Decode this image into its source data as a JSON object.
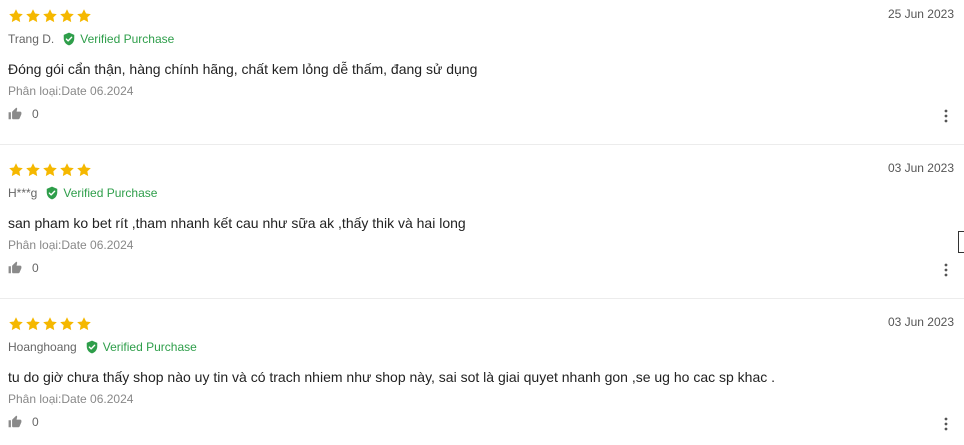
{
  "colors": {
    "star": "#f5b800",
    "verified": "#2e9e4a",
    "divider": "#ececec"
  },
  "verified_label": "Verified Purchase",
  "reviews": [
    {
      "rating": 5,
      "author": "Trang D.",
      "date": "25 Jun 2023",
      "content": "Đóng gói cẩn thận, hàng chính hãng, chất kem lỏng dễ thấm, đang sử dụng",
      "variant": "Phân loại:Date 06.2024",
      "likes": "0"
    },
    {
      "rating": 5,
      "author": "H***g",
      "date": "03 Jun 2023",
      "content": "san pham ko bet rít ,tham nhanh kết cau như sữa ak ,thấy thik và hai long",
      "variant": "Phân loại:Date 06.2024",
      "likes": "0"
    },
    {
      "rating": 5,
      "author": "Hoanghoang",
      "date": "03 Jun 2023",
      "content": "tu do giờ chưa thấy shop nào uy tin và có trach nhiem như shop này, sai sot là giai quyet nhanh gon ,se ug ho cac sp khac .",
      "variant": "Phân loại:Date 06.2024",
      "likes": "0"
    }
  ],
  "icons": {
    "star": "star-icon",
    "verified": "verified-check-icon",
    "like": "thumbs-up-icon",
    "more": "more-vertical-icon"
  }
}
